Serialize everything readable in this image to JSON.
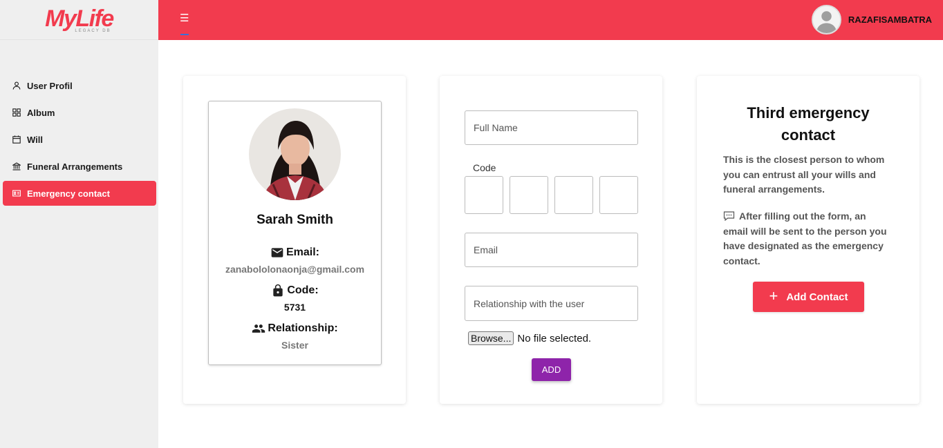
{
  "brand": {
    "logo_text": "MyLife",
    "logo_sub": "LEGACY DB",
    "color": "#f23b4e"
  },
  "header": {
    "menu_icon": "hamburger-icon",
    "username": "RAZAFISAMBATRA"
  },
  "sidebar": {
    "items": [
      {
        "label": "User Profil",
        "icon": "user-icon"
      },
      {
        "label": "Album",
        "icon": "grid-icon"
      },
      {
        "label": "Will",
        "icon": "calendar-icon"
      },
      {
        "label": "Funeral Arrangements",
        "icon": "bank-icon"
      },
      {
        "label": "Emergency contact",
        "icon": "id-card-icon",
        "active": true
      }
    ]
  },
  "profile": {
    "name": "Sarah Smith",
    "email_label": "Email:",
    "email": "zanabololonaonja@gmail.com",
    "code_label": "Code:",
    "code": "5731",
    "relationship_label": "Relationship:",
    "relationship": "Sister"
  },
  "form": {
    "full_name_placeholder": "Full Name",
    "code_label": "Code",
    "email_placeholder": "Email",
    "relationship_placeholder": "Relationship with the user",
    "browse_label": "Browse...",
    "file_status": "No file selected.",
    "submit_label": "ADD",
    "submit_color": "#8e24aa"
  },
  "info": {
    "title": "Third emergency contact",
    "description": "This is the closest person to whom you can entrust all your wills and funeral arrangements.",
    "note": "After filling out the form, an email will be sent to the person you have designated as the emergency contact.",
    "button_label": "Add Contact"
  }
}
